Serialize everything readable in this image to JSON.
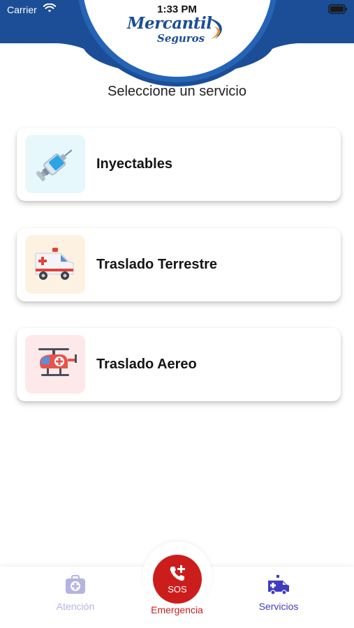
{
  "status_bar": {
    "carrier": "Carrier",
    "time": "1:33 PM"
  },
  "brand": {
    "name": "Mercantil",
    "subtitle": "Seguros",
    "primary_color": "#1b4e96",
    "accent_color": "#e8902c"
  },
  "page": {
    "title": "Seleccione un servicio"
  },
  "services": [
    {
      "label": "Inyectables",
      "icon": "syringe-icon",
      "tile_color": "#e6f8fb"
    },
    {
      "label": "Traslado Terrestre",
      "icon": "ambulance-icon",
      "tile_color": "#fdf1e2"
    },
    {
      "label": "Traslado Aereo",
      "icon": "helicopter-icon",
      "tile_color": "#fde9ea"
    }
  ],
  "tabbar": {
    "tabs": [
      {
        "label": "Atención",
        "icon": "medical-kit-icon",
        "color": "#b5b3e3",
        "active": false
      },
      {
        "label": "Emergencia",
        "icon": "phone-plus-icon",
        "color": "#cc1d1d",
        "active": false,
        "badge_text": "SOS"
      },
      {
        "label": "Servicios",
        "icon": "ambulance-icon",
        "color": "#3f3cbf",
        "active": true
      }
    ]
  }
}
